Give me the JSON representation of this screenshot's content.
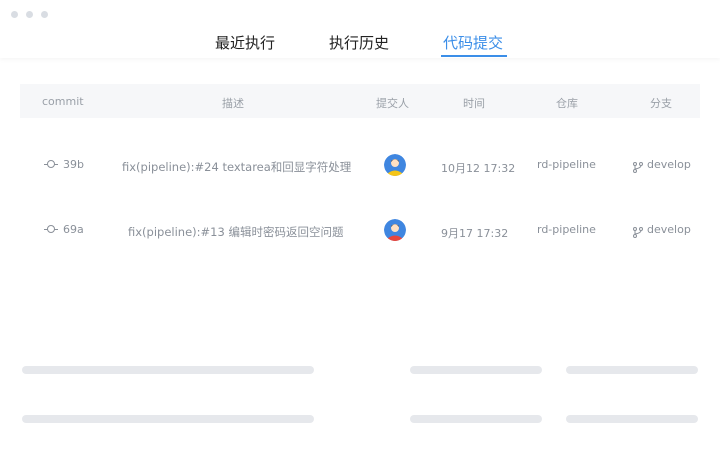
{
  "tabs": [
    {
      "label": "最近执行"
    },
    {
      "label": "执行历史"
    },
    {
      "label": "代码提交"
    }
  ],
  "columns": {
    "commit": "commit",
    "desc": "描述",
    "author": "提交人",
    "time": "时间",
    "repo": "仓库",
    "branch": "分支"
  },
  "rows": [
    {
      "commit": "39b",
      "desc": "fix(pipeline):#24 textarea和回显字符处理",
      "avatar_color": "#f5c518",
      "time": "10月12 17:32",
      "repo": "rd-pipeline",
      "branch": "develop"
    },
    {
      "commit": "69a",
      "desc": "fix(pipeline):#13 编辑时密码返回空问题",
      "avatar_color": "#e8463c",
      "time": "9月17 17:32",
      "repo": "rd-pipeline",
      "branch": "develop"
    }
  ],
  "colors": {
    "accent": "#3b8ee8",
    "header_bg": "#f6f7f9",
    "skeleton": "#e6e8ec",
    "avatar_bg": "#3f86e0"
  }
}
